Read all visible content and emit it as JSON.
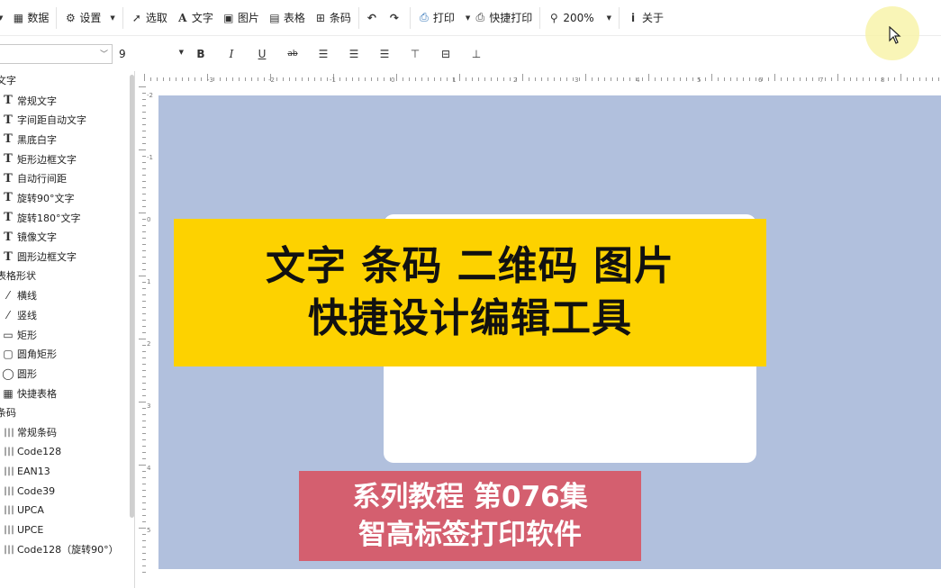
{
  "toolbar": {
    "data": "数据",
    "settings": "设置",
    "select": "选取",
    "text": "文字",
    "image": "图片",
    "table": "表格",
    "barcode": "条码",
    "print": "打印",
    "quick_print": "快捷打印",
    "zoom": "200%",
    "about": "关于"
  },
  "format": {
    "font_name": "",
    "font_size": "9",
    "bold": "B",
    "italic": "I",
    "underline": "U",
    "strike": "ab"
  },
  "sidebar": {
    "text_group": "文字",
    "text_items": [
      "常规文字",
      "字间距自动文字",
      "黑底白字",
      "矩形边框文字",
      "自动行间距",
      "旋转90°文字",
      "旋转180°文字",
      "镜像文字",
      "圆形边框文字"
    ],
    "shape_group": "表格形状",
    "shape_items": [
      "横线",
      "竖线",
      "矩形",
      "圆角矩形",
      "圆形",
      "快捷表格"
    ],
    "barcode_group": "条码",
    "barcode_items": [
      "常规条码",
      "Code128",
      "EAN13",
      "Code39",
      "UPCA",
      "UPCE",
      "Code128（旋转90°）"
    ]
  },
  "ruler": {
    "top_labels": [
      "-3",
      "-2",
      "-1",
      "0",
      "1",
      "2",
      "3",
      "4",
      "5",
      "6",
      "7",
      "8"
    ],
    "left_labels": [
      "-2",
      "-1",
      "0",
      "1",
      "2",
      "3",
      "4",
      "5"
    ]
  },
  "overlay": {
    "title_line1": "文字 条码 二维码 图片",
    "title_line2": "快捷设计编辑工具",
    "series_line1": "系列教程 第076集",
    "series_line2": "智高标签打印软件"
  },
  "colors": {
    "canvas_bg": "#b1c0dd",
    "title_banner": "#fdd200",
    "series_banner": "#d45f6f",
    "cursor_halo": "#f8f3aa"
  },
  "icons": {
    "data": "database-icon",
    "settings": "wrench-icon",
    "select": "pointer-icon",
    "text": "letter-a-icon",
    "image": "image-icon",
    "table": "table-icon",
    "barcode": "qr-grid-icon",
    "undo": "undo-icon",
    "redo": "redo-icon",
    "print": "printer-icon",
    "zoom": "magnifier-icon",
    "about": "info-icon"
  }
}
